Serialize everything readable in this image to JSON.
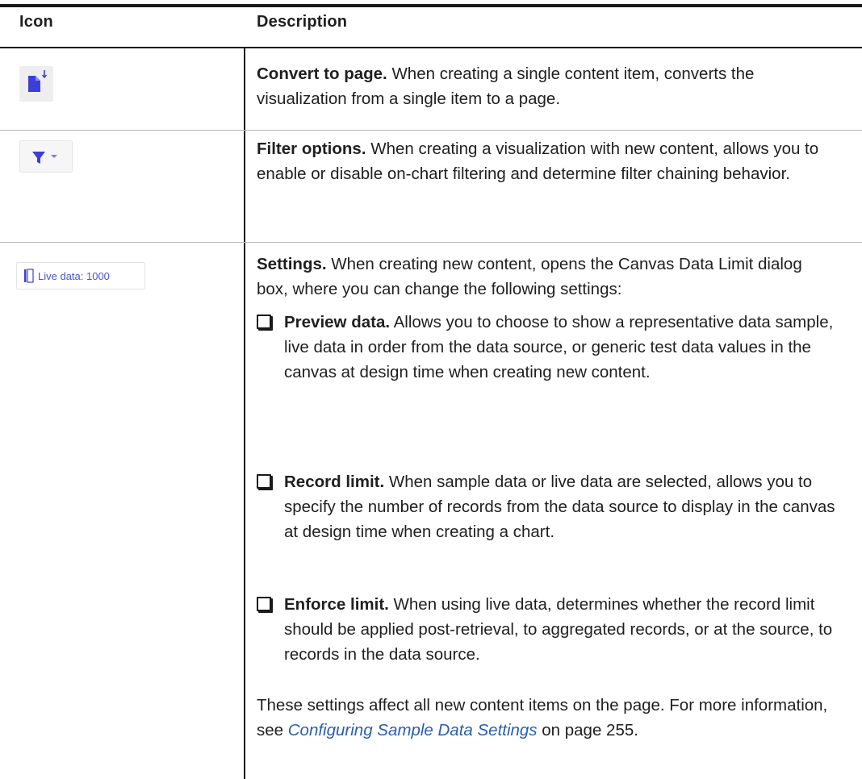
{
  "table": {
    "headers": {
      "icon": "Icon",
      "description": "Description"
    },
    "rows": [
      {
        "icon_name": "convert-to-page-icon",
        "title": "Convert to page.",
        "text": " When creating a single content item, converts the visualization from a single item to a page."
      },
      {
        "icon_name": "filter-options-icon",
        "title": "Filter options.",
        "text": " When creating a visualization with new content, allows you to enable or disable on-chart filtering and determine filter chaining behavior."
      },
      {
        "icon_name": "live-data-settings-icon",
        "icon_label": "Live data: 1000",
        "title": "Settings.",
        "text": " When creating new content, opens the Canvas Data Limit dialog box, where you can change the following settings:",
        "bullets": [
          {
            "title": "Preview data.",
            "text": " Allows you to choose to show a representative data sample, live data in order from the data source, or generic test data values in the canvas at design time when creating new content."
          },
          {
            "title": "Record limit.",
            "text": " When sample data or live data are selected, allows you to specify the number of records from the data source to display in the canvas at design time when creating a chart."
          },
          {
            "title": "Enforce limit.",
            "text": " When using live data, determines whether the record limit should be applied post-retrieval, to aggregated records, or at the source, to records in the data source."
          }
        ],
        "footer": {
          "text_before": "These settings affect all new content items on the page. For more information, see ",
          "link": "Configuring Sample Data Settings",
          "text_after": " on page 255."
        }
      }
    ]
  },
  "colors": {
    "icon_accent": "#3b3fd6",
    "link": "#2a5db0",
    "rule": "#1a1a1a"
  }
}
